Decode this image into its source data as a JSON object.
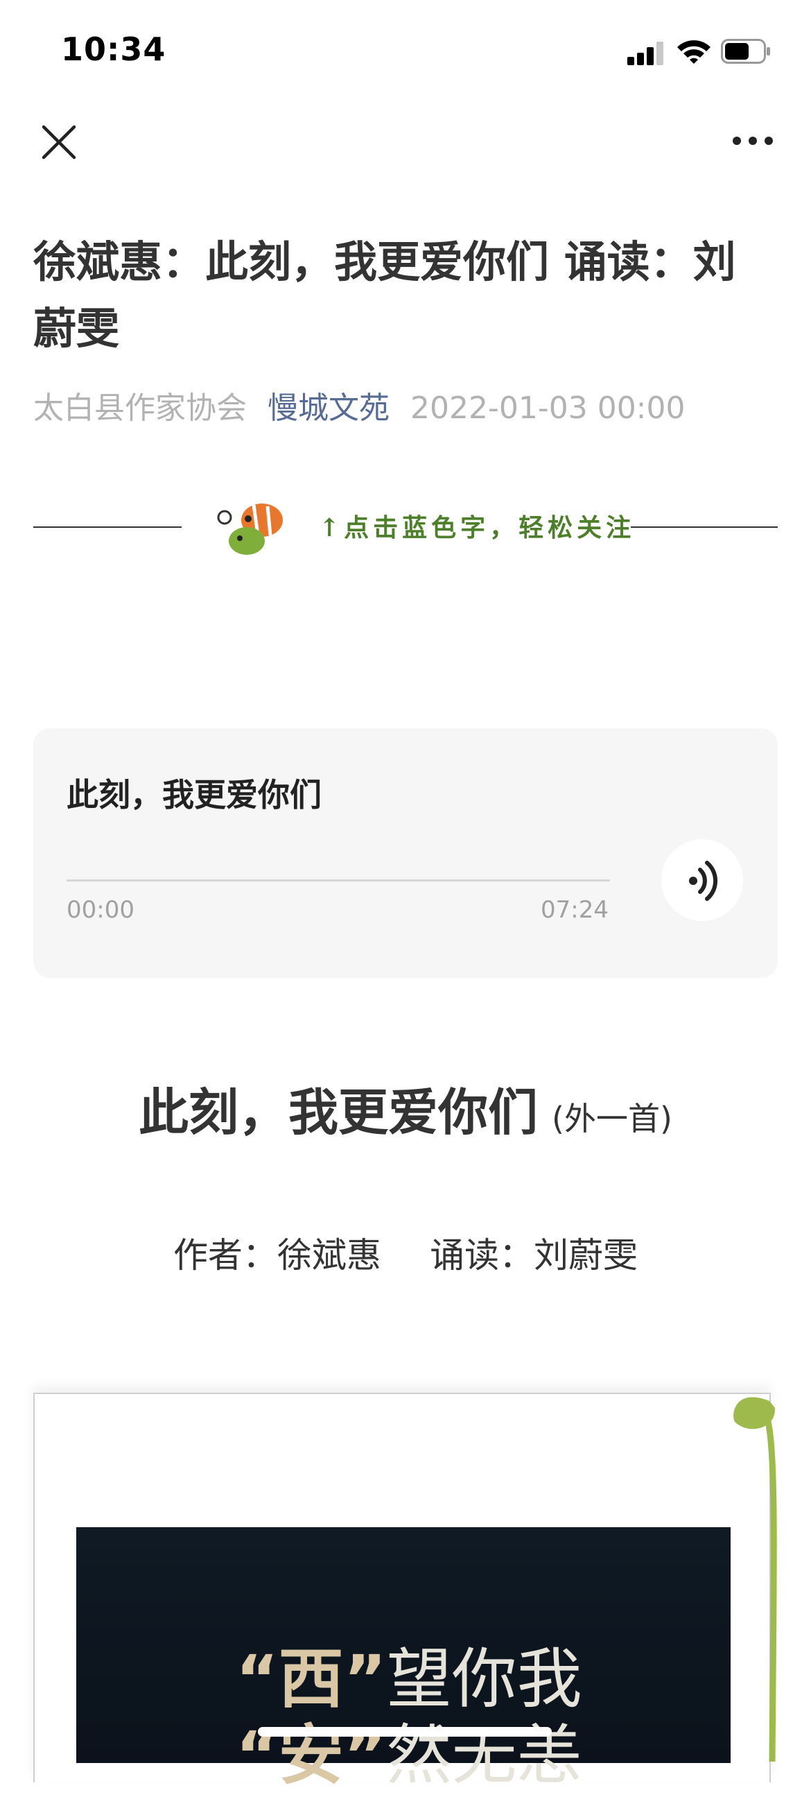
{
  "status_bar": {
    "time": "10:34"
  },
  "article": {
    "title": "徐斌惠：此刻，我更爱你们 诵读：刘蔚雯",
    "author_org": "太白县作家协会",
    "account": "慢城文苑",
    "date": "2022-01-03 00:00"
  },
  "follow_banner": {
    "text": "↑点击蓝色字，轻松关注"
  },
  "audio": {
    "title": "此刻，我更爱你们",
    "current_time": "00:00",
    "duration": "07:24",
    "progress": 0
  },
  "poem": {
    "title": "此刻，我更爱你们",
    "subtitle": "(外一首)",
    "author_label": "作者：徐斌惠",
    "reader_label": "诵读：刘蔚雯"
  },
  "poster": {
    "line1_quote": "“西”",
    "line1_rest": "望你我",
    "line2_quote": "“安”",
    "line2_rest": "然无恙"
  },
  "icons": {
    "close": "close-icon",
    "more": "more-icon",
    "audio": "sound-wave-icon",
    "fish": "fish-icon",
    "signal": "signal-icon",
    "wifi": "wifi-icon",
    "battery": "battery-icon"
  },
  "colors": {
    "link": "#576b95",
    "meta": "#b2b2b2",
    "banner_green": "#4d7f2a",
    "vine_green": "#9fba4c",
    "poster_bg": "#0f1a24"
  }
}
